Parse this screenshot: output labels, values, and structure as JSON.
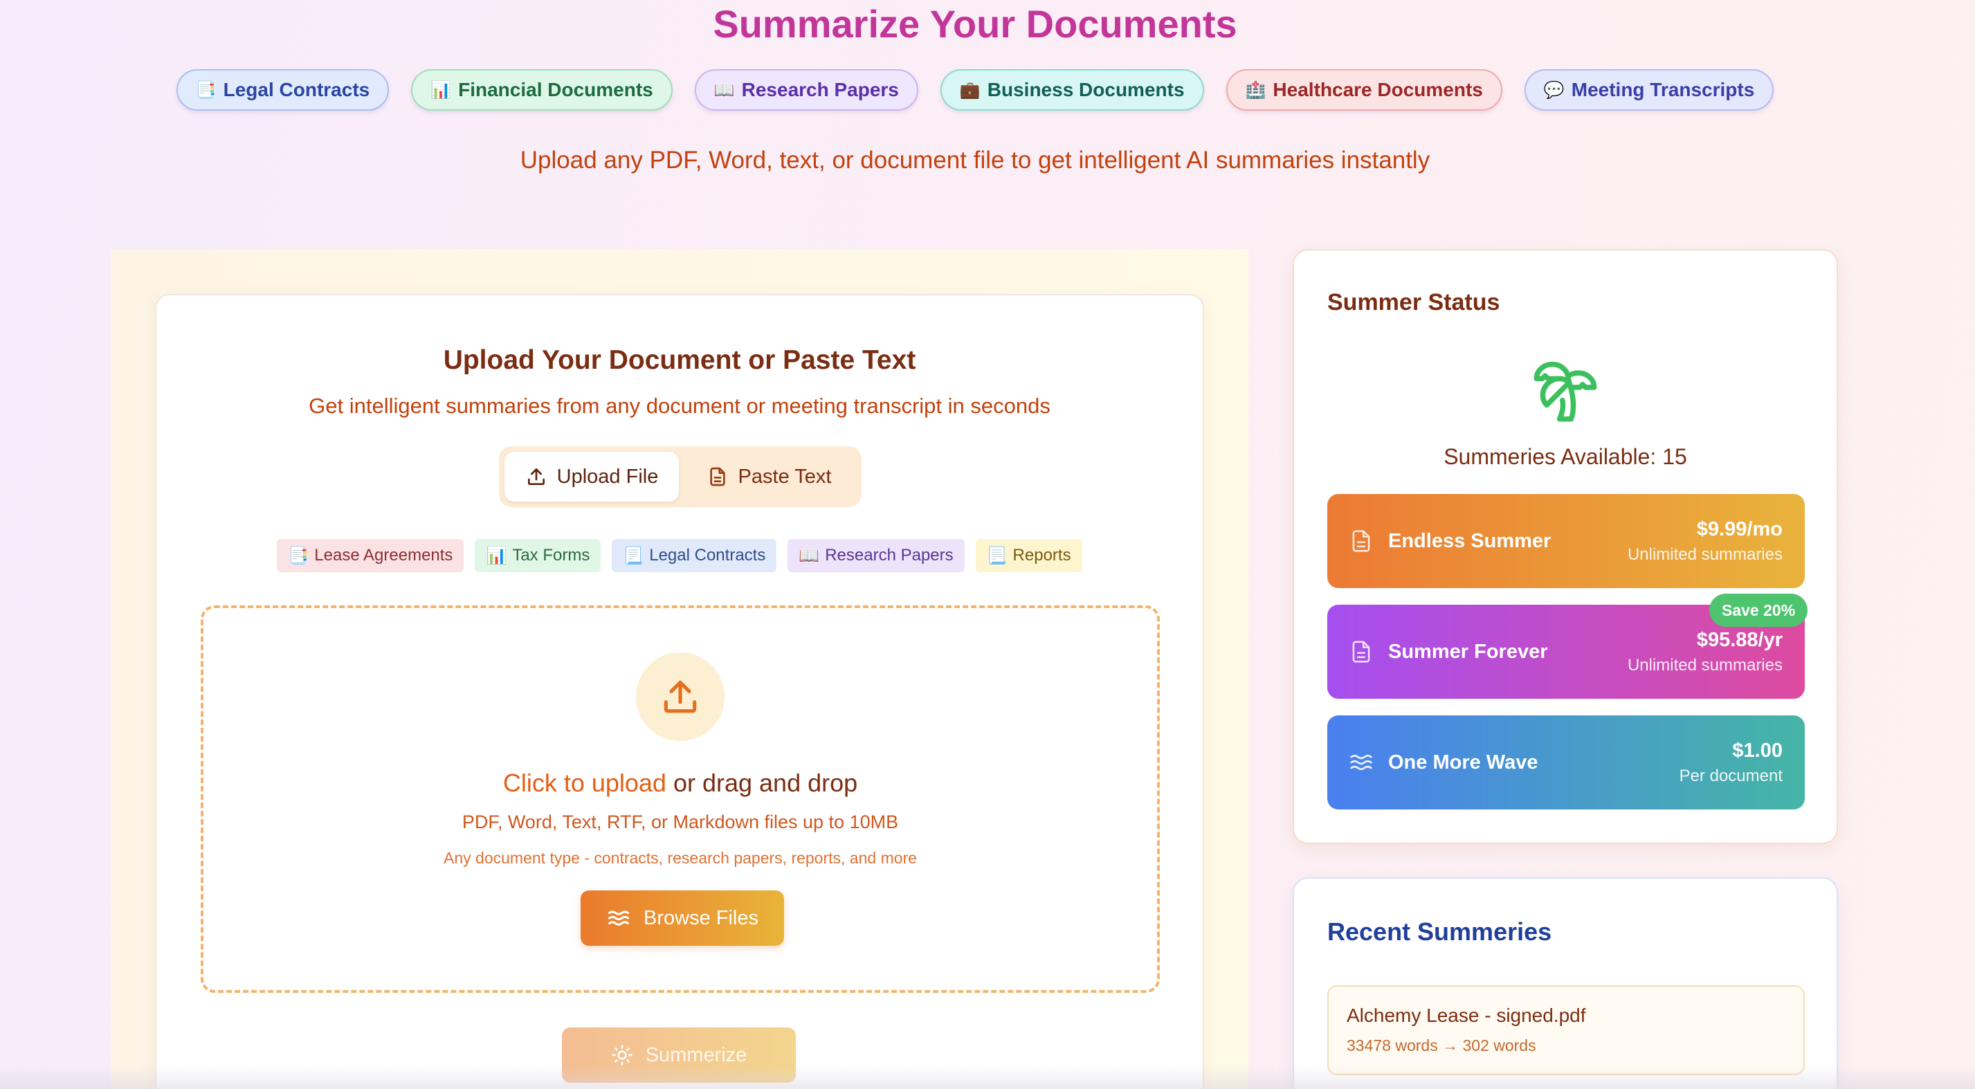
{
  "header": {
    "title": "Summarize Your Documents",
    "subtitle": "Upload any PDF, Word, text, or document file to get intelligent AI summaries instantly",
    "categories": [
      {
        "icon": "📑",
        "label": "Legal Contracts"
      },
      {
        "icon": "📊",
        "label": "Financial Documents"
      },
      {
        "icon": "📖",
        "label": "Research Papers"
      },
      {
        "icon": "💼",
        "label": "Business Documents"
      },
      {
        "icon": "🏥",
        "label": "Healthcare Documents"
      },
      {
        "icon": "💬",
        "label": "Meeting Transcripts"
      }
    ]
  },
  "upload": {
    "heading": "Upload Your Document or Paste Text",
    "subheading": "Get intelligent summaries from any document or meeting transcript in seconds",
    "mode_upload": "Upload File",
    "mode_paste": "Paste Text",
    "tags": [
      {
        "icon": "📑",
        "label": "Lease Agreements"
      },
      {
        "icon": "📊",
        "label": "Tax Forms"
      },
      {
        "icon": "📃",
        "label": "Legal Contracts"
      },
      {
        "icon": "📖",
        "label": "Research Papers"
      },
      {
        "icon": "📃",
        "label": "Reports"
      }
    ],
    "dropzone": {
      "link_text": "Click to upload",
      "rest_text": " or drag and drop",
      "formats": "PDF, Word, Text, RTF, or Markdown files up to 10MB",
      "hint": "Any document type - contracts, research papers, reports, and more",
      "browse_label": "Browse Files"
    },
    "summarize_label": "Summerize"
  },
  "status": {
    "title": "Summer Status",
    "available": "Summeries Available: 15",
    "plans": [
      {
        "name": "Endless Summer",
        "price": "$9.99/mo",
        "note": "Unlimited summaries",
        "icon": "document-icon"
      },
      {
        "name": "Summer Forever",
        "price": "$95.88/yr",
        "note": "Unlimited summaries",
        "icon": "document-icon",
        "badge": "Save 20%"
      },
      {
        "name": "One More Wave",
        "price": "$1.00",
        "note": "Per document",
        "icon": "waves-icon"
      }
    ]
  },
  "recent": {
    "title": "Recent Summeries",
    "items": [
      {
        "name": "Alchemy Lease - signed.pdf",
        "meta": "33478 words → 302 words"
      }
    ]
  },
  "colors": {
    "title_pink": "#c2369a",
    "accent_orange": "#e35f15",
    "brown_text": "#7a2d12",
    "save_green": "#4fc46f"
  }
}
